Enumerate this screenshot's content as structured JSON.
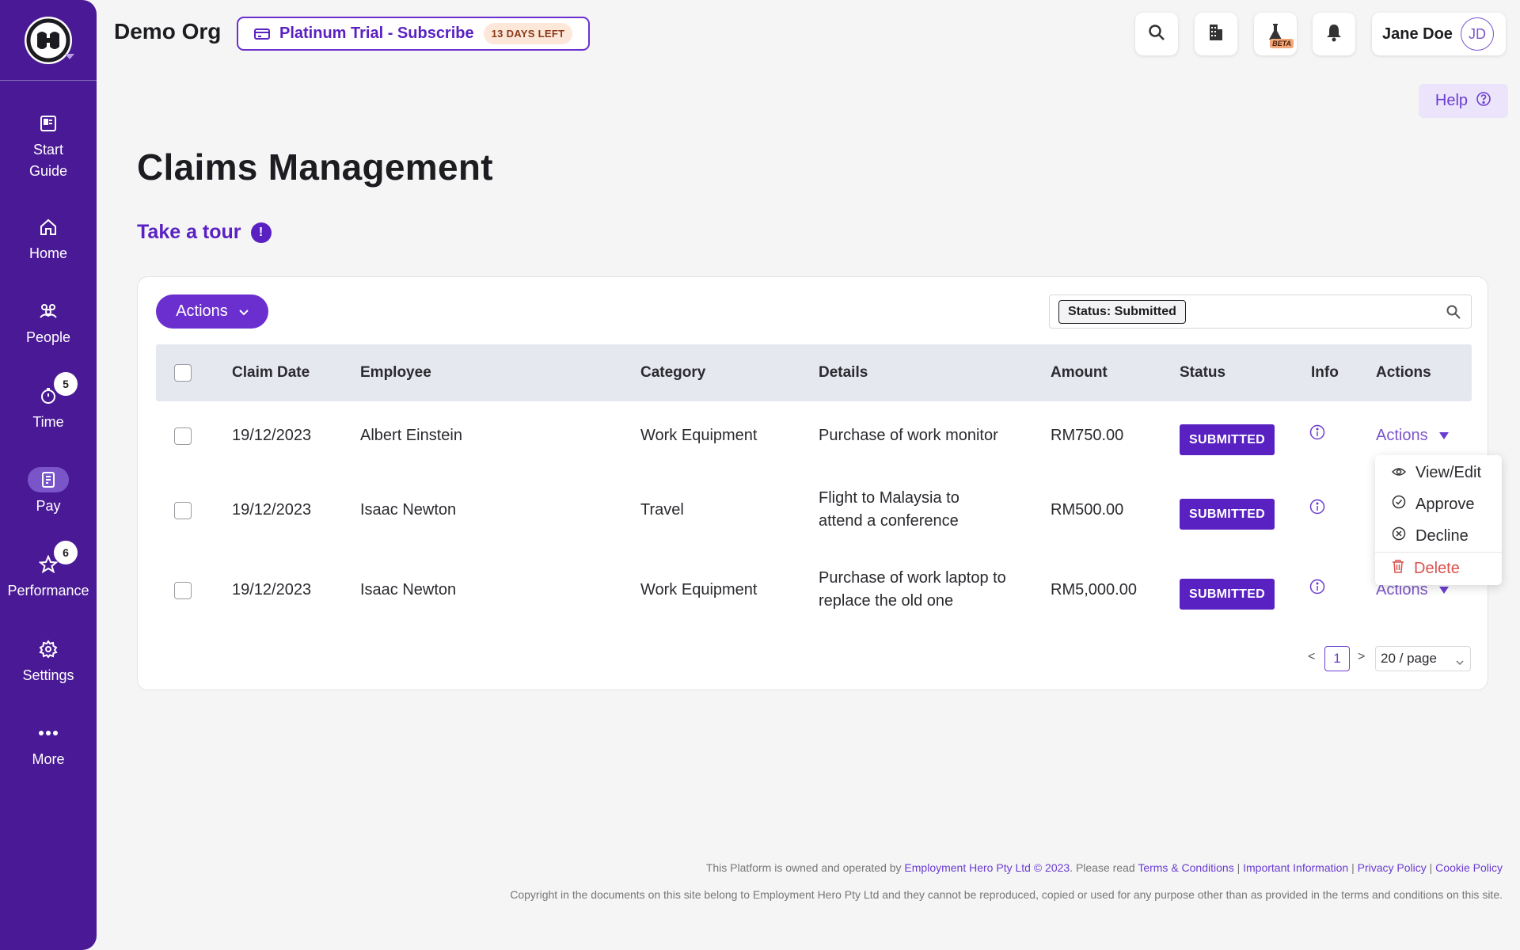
{
  "org": {
    "name": "Demo Org"
  },
  "trial": {
    "label": "Platinum Trial - Subscribe",
    "days_left": "13 DAYS LEFT"
  },
  "user": {
    "name": "Jane Doe",
    "initials": "JD"
  },
  "topbar": {
    "beta_label": "BETA"
  },
  "help": {
    "label": "Help"
  },
  "sidebar": {
    "items": [
      {
        "label": "Start Guide",
        "icon": "book-icon"
      },
      {
        "label": "Home",
        "icon": "home-icon"
      },
      {
        "label": "People",
        "icon": "people-icon"
      },
      {
        "label": "Time",
        "icon": "timer-icon",
        "badge": "5"
      },
      {
        "label": "Pay",
        "icon": "payslip-icon",
        "active": true
      },
      {
        "label": "Performance",
        "icon": "star-icon",
        "badge": "6"
      },
      {
        "label": "Settings",
        "icon": "gear-icon"
      },
      {
        "label": "More",
        "icon": "more-icon"
      }
    ]
  },
  "page": {
    "title": "Claims Management",
    "tour_label": "Take a tour"
  },
  "toolbar": {
    "actions_label": "Actions",
    "filter_tag": "Status: Submitted"
  },
  "table": {
    "headers": [
      "Claim Date",
      "Employee",
      "Category",
      "Details",
      "Amount",
      "Status",
      "Info",
      "Actions"
    ],
    "rows": [
      {
        "date": "19/12/2023",
        "employee": "Albert Einstein",
        "category": "Work Equipment",
        "details_1": "Purchase of work monitor",
        "details_2": "",
        "amount": "RM750.00",
        "status": "SUBMITTED",
        "actions": "Actions"
      },
      {
        "date": "19/12/2023",
        "employee": "Isaac Newton",
        "category": "Travel",
        "details_1": "Flight to Malaysia to",
        "details_2": "attend a conference",
        "amount": "RM500.00",
        "status": "SUBMITTED",
        "actions": "Actions"
      },
      {
        "date": "19/12/2023",
        "employee": "Isaac Newton",
        "category": "Work Equipment",
        "details_1": "Purchase of work laptop to",
        "details_2": "replace the old one",
        "amount": "RM5,000.00",
        "status": "SUBMITTED",
        "actions": "Actions"
      }
    ]
  },
  "dropdown": {
    "view_edit": "View/Edit",
    "approve": "Approve",
    "decline": "Decline",
    "delete": "Delete"
  },
  "pagination": {
    "prev": "<",
    "next": ">",
    "current_page": "1",
    "page_size": "20 / page"
  },
  "footer": {
    "line1_prefix": "This Platform is owned and operated by ",
    "company_link": "Employment Hero Pty Ltd © 2023",
    "line1_mid": ". Please read ",
    "terms": "Terms & Conditions",
    "sep": " | ",
    "important": "Important Information",
    "privacy": "Privacy Policy",
    "cookie": "Cookie Policy",
    "line2": "Copyright in the documents on this site belong to Employment Hero Pty Ltd and they cannot be reproduced, copied or used for any purpose other than as provided in the terms and conditions on this site."
  },
  "colors": {
    "brand": "#4a1a96",
    "accent": "#6b2fd0",
    "danger": "#d9534f"
  }
}
